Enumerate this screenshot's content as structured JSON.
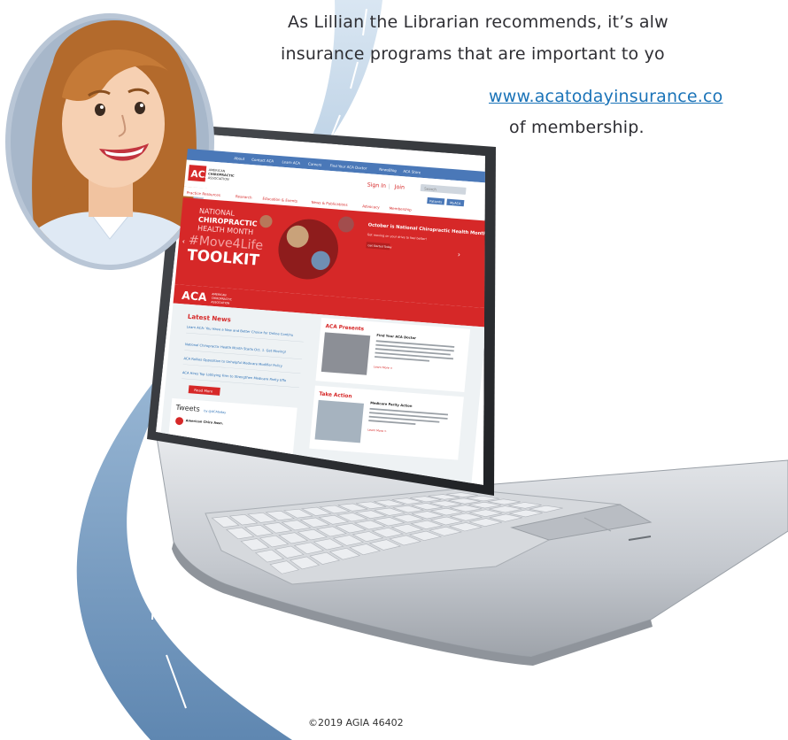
{
  "intro": {
    "line1": "As Lillian the Librarian recommends, it’s alw",
    "line2": "insurance programs that are important to yo",
    "link": "www.acatodayinsurance.co",
    "line3": "of membership."
  },
  "footer": "©2019 AGIA    46402",
  "website": {
    "top_nav": [
      "About",
      "Contact ACA",
      "Learn ACA",
      "Careers",
      "Find Your ACA Doctor",
      "NewsBlog",
      "ACA Store"
    ],
    "logo_lines": [
      "AMERICAN",
      "CHIROPRACTIC",
      "ASSOCIATION"
    ],
    "sign_in": "Sign In",
    "join": "Join",
    "search_placeholder": "Search",
    "patients_button": "Patients",
    "myaca_button": "MyACA",
    "main_nav": [
      "Practice Resources",
      "Research",
      "Education & Events",
      "News & Publications",
      "Advocacy",
      "Membership"
    ],
    "hero": {
      "line1": "NATIONAL",
      "line2": "CHIROPRACTIC",
      "line3": "HEALTH MONTH",
      "hashtag": "#Move4Life",
      "toolkit": "TOOLKIT",
      "side_title": "October is National Chiropractic Health Month",
      "side_text": "Get moving on your drive to feel better!",
      "side_button": "Get Started Today"
    },
    "brand_logo_text": [
      "AMERICAN",
      "CHIROPRACTIC",
      "ASSOCIATION"
    ],
    "latest_news": {
      "title": "Latest News",
      "items": [
        "Learn ACA: You Have a New and Better Choice for Online Continuing Education",
        "National Chiropractic Health Month Starts Oct. 1. Get Moving!",
        "ACA Rallies Opposition to Unhelpful Medicare Modifier Policy",
        "ACA Hires Top Lobbying Firm to Strengthen Medicare Parity Efforts"
      ],
      "read_more": "Read More"
    },
    "tweets": {
      "title": "Tweets",
      "by": "by @ACAtoday",
      "account": "American Chiro Assn."
    },
    "aca_presents": {
      "title": "ACA Presents",
      "heading": "Find Your ACA Doctor",
      "link": "Learn More >"
    },
    "take_action": {
      "title": "Take Action",
      "heading": "Medicare Parity Action",
      "link": "Learn More >"
    }
  },
  "colors": {
    "road": "#6e93b8",
    "road_light": "#a9c3dc",
    "aca_red": "#d62828",
    "laptop_silver": "#c8ccd2",
    "avatar_ring": "#b9c6d6",
    "link_blue": "#1a73b8"
  }
}
